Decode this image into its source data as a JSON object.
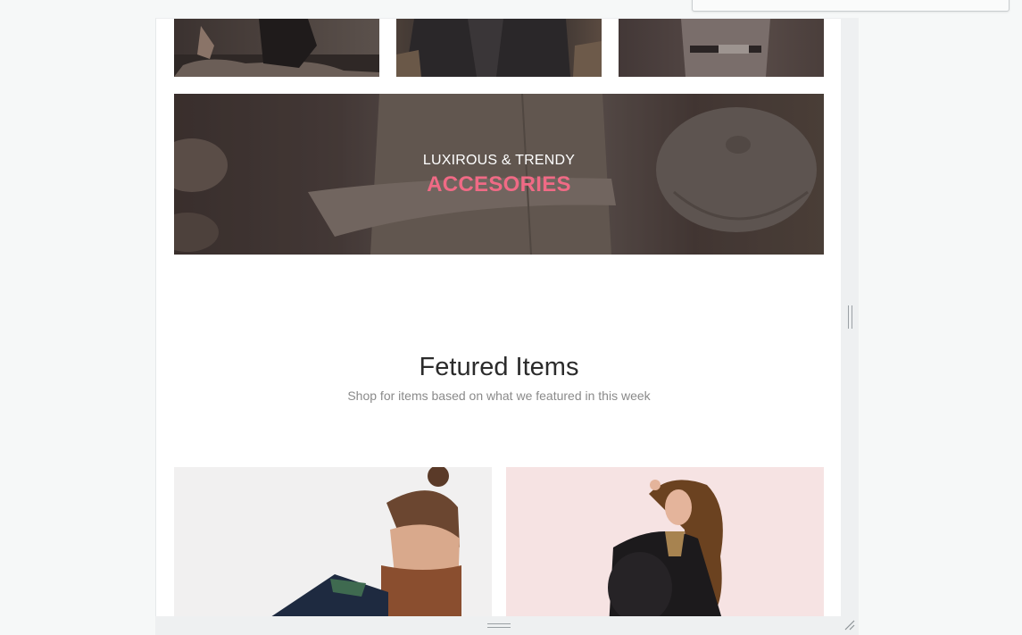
{
  "banner": {
    "subtitle": "LUXIROUS & TRENDY",
    "title": "ACCESORIES"
  },
  "featured": {
    "title": "Fetured Items",
    "subtitle": "Shop for items based on what we featured in this week"
  },
  "colors": {
    "accent": "#f06a85",
    "heading": "#2b2b2b",
    "muted": "#8a8a8a",
    "card_bg_1": "#f1f0f0",
    "card_bg_2": "#f6e3e3"
  }
}
